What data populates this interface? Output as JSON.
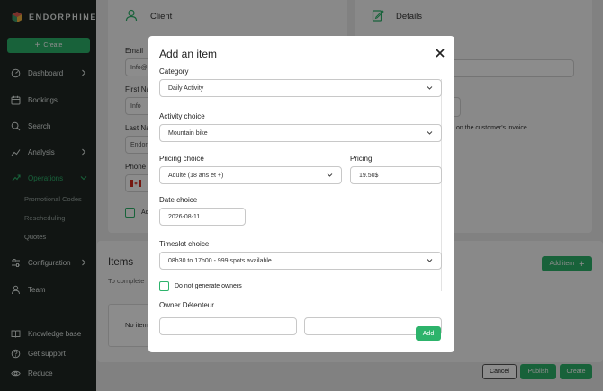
{
  "sidebar": {
    "brand": "ENDORPHINE",
    "create_label": "Create",
    "items": [
      {
        "label": "Dashboard"
      },
      {
        "label": "Bookings"
      },
      {
        "label": "Search"
      },
      {
        "label": "Analysis"
      },
      {
        "label": "Operations"
      },
      {
        "label": "Configuration"
      },
      {
        "label": "Team"
      }
    ],
    "sub_items": [
      "Promotional Codes",
      "Rescheduling",
      "Quotes"
    ],
    "bottom_items": [
      {
        "label": "Knowledge base"
      },
      {
        "label": "Get support"
      },
      {
        "label": "Reduce"
      }
    ]
  },
  "main": {
    "client_title": "Client",
    "details_title": "Details",
    "email_label": "Email",
    "email_value": "Info@",
    "firstname_label": "First Na",
    "firstname_value": "Info",
    "lastname_label": "Last Na",
    "lastname_value": "Endor",
    "phone_label": "Phone N",
    "checkbox_label": "Ad",
    "invoice_text": "on the customer's invoice",
    "items_title": "Items",
    "items_sub": "To complete",
    "no_items": "No item",
    "add_item_label": "Add item",
    "cancel_label": "Cancel",
    "publish_label": "Publish",
    "create_label": "Create"
  },
  "modal": {
    "title": "Add an item",
    "category_label": "Category",
    "category_value": "Daily Activity",
    "activity_label": "Activity choice",
    "activity_value": "Mountain bike",
    "pricing_choice_label": "Pricing choice",
    "pricing_choice_value": "Adulte (18 ans et +)",
    "pricing_label": "Pricing",
    "pricing_value": "19.50$",
    "date_label": "Date choice",
    "date_value": "2026-08-11",
    "timeslot_label": "Timeslot choice",
    "timeslot_value": "08h30 to 17h00 - 999 spots available",
    "no_owners_label": "Do not generate owners",
    "owner_label": "Owner Détenteur",
    "add_label": "Add"
  },
  "colors": {
    "accent": "#2db36b",
    "sidebar_bg": "#1f2724",
    "overlay": "rgba(0,0,0,0.45)"
  }
}
